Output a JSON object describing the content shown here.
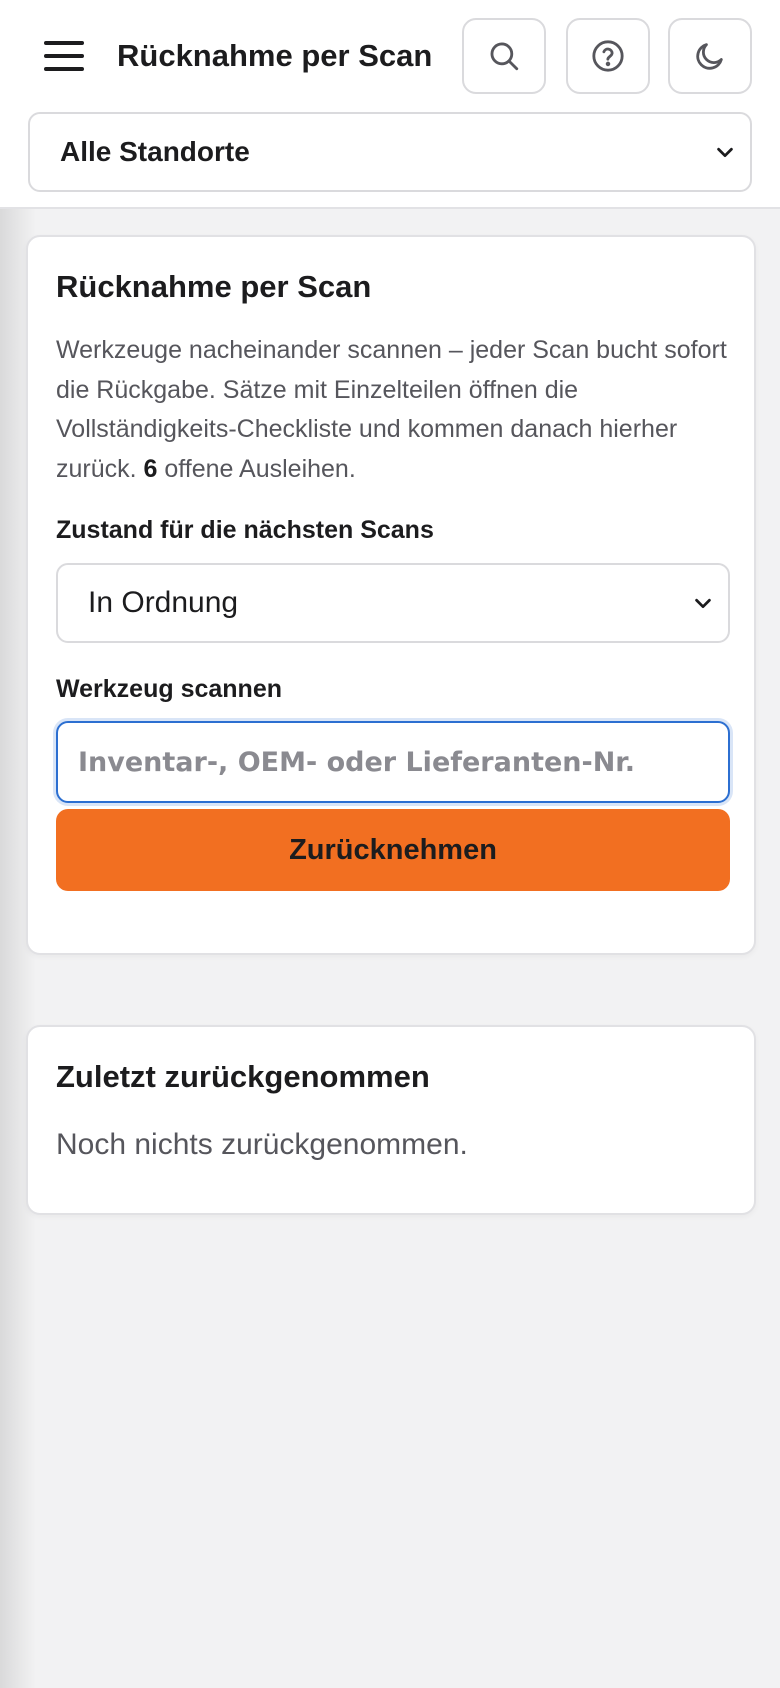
{
  "header": {
    "title": "Rücknahme per Scan",
    "icons": {
      "menu": "hamburger-menu-icon",
      "search": "search-icon",
      "help": "help-circle-icon",
      "theme": "moon-icon"
    }
  },
  "location_select": {
    "selected": "Alle Standorte"
  },
  "main_card": {
    "title": "Rücknahme per Scan",
    "description_before": "Werkzeuge nacheinander scannen – jeder Scan bucht sofort die Rückgabe. Sätze mit Einzelteilen öffnen die Vollständigkeits-Checkliste und kommen danach hierher zurück.",
    "open_loans_count": "6",
    "description_after": "offene Ausleihen.",
    "condition_label": "Zustand für die nächsten Scans",
    "condition_selected": "In Ordnung",
    "scan_label": "Werkzeug scannen",
    "scan_placeholder": "Inventar-, OEM- oder Lieferanten-Nr.",
    "scan_value": "",
    "submit_label": "Zurücknehmen"
  },
  "recent_card": {
    "title": "Zuletzt zurückgenommen",
    "empty_text": "Noch nichts zurückgenommen."
  },
  "colors": {
    "accent": "#f26f21",
    "focus": "#2c6fd1",
    "background": "#f2f2f3"
  }
}
